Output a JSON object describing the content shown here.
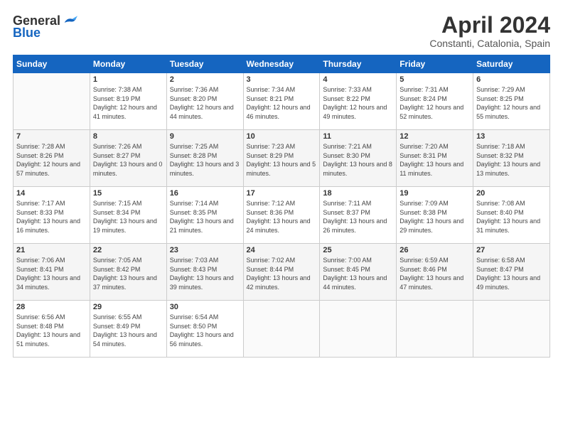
{
  "header": {
    "logo_general": "General",
    "logo_blue": "Blue",
    "month_title": "April 2024",
    "subtitle": "Constanti, Catalonia, Spain"
  },
  "weekdays": [
    "Sunday",
    "Monday",
    "Tuesday",
    "Wednesday",
    "Thursday",
    "Friday",
    "Saturday"
  ],
  "weeks": [
    [
      {
        "day": "",
        "sunrise": "",
        "sunset": "",
        "daylight": ""
      },
      {
        "day": "1",
        "sunrise": "Sunrise: 7:38 AM",
        "sunset": "Sunset: 8:19 PM",
        "daylight": "Daylight: 12 hours and 41 minutes."
      },
      {
        "day": "2",
        "sunrise": "Sunrise: 7:36 AM",
        "sunset": "Sunset: 8:20 PM",
        "daylight": "Daylight: 12 hours and 44 minutes."
      },
      {
        "day": "3",
        "sunrise": "Sunrise: 7:34 AM",
        "sunset": "Sunset: 8:21 PM",
        "daylight": "Daylight: 12 hours and 46 minutes."
      },
      {
        "day": "4",
        "sunrise": "Sunrise: 7:33 AM",
        "sunset": "Sunset: 8:22 PM",
        "daylight": "Daylight: 12 hours and 49 minutes."
      },
      {
        "day": "5",
        "sunrise": "Sunrise: 7:31 AM",
        "sunset": "Sunset: 8:24 PM",
        "daylight": "Daylight: 12 hours and 52 minutes."
      },
      {
        "day": "6",
        "sunrise": "Sunrise: 7:29 AM",
        "sunset": "Sunset: 8:25 PM",
        "daylight": "Daylight: 12 hours and 55 minutes."
      }
    ],
    [
      {
        "day": "7",
        "sunrise": "Sunrise: 7:28 AM",
        "sunset": "Sunset: 8:26 PM",
        "daylight": "Daylight: 12 hours and 57 minutes."
      },
      {
        "day": "8",
        "sunrise": "Sunrise: 7:26 AM",
        "sunset": "Sunset: 8:27 PM",
        "daylight": "Daylight: 13 hours and 0 minutes."
      },
      {
        "day": "9",
        "sunrise": "Sunrise: 7:25 AM",
        "sunset": "Sunset: 8:28 PM",
        "daylight": "Daylight: 13 hours and 3 minutes."
      },
      {
        "day": "10",
        "sunrise": "Sunrise: 7:23 AM",
        "sunset": "Sunset: 8:29 PM",
        "daylight": "Daylight: 13 hours and 5 minutes."
      },
      {
        "day": "11",
        "sunrise": "Sunrise: 7:21 AM",
        "sunset": "Sunset: 8:30 PM",
        "daylight": "Daylight: 13 hours and 8 minutes."
      },
      {
        "day": "12",
        "sunrise": "Sunrise: 7:20 AM",
        "sunset": "Sunset: 8:31 PM",
        "daylight": "Daylight: 13 hours and 11 minutes."
      },
      {
        "day": "13",
        "sunrise": "Sunrise: 7:18 AM",
        "sunset": "Sunset: 8:32 PM",
        "daylight": "Daylight: 13 hours and 13 minutes."
      }
    ],
    [
      {
        "day": "14",
        "sunrise": "Sunrise: 7:17 AM",
        "sunset": "Sunset: 8:33 PM",
        "daylight": "Daylight: 13 hours and 16 minutes."
      },
      {
        "day": "15",
        "sunrise": "Sunrise: 7:15 AM",
        "sunset": "Sunset: 8:34 PM",
        "daylight": "Daylight: 13 hours and 19 minutes."
      },
      {
        "day": "16",
        "sunrise": "Sunrise: 7:14 AM",
        "sunset": "Sunset: 8:35 PM",
        "daylight": "Daylight: 13 hours and 21 minutes."
      },
      {
        "day": "17",
        "sunrise": "Sunrise: 7:12 AM",
        "sunset": "Sunset: 8:36 PM",
        "daylight": "Daylight: 13 hours and 24 minutes."
      },
      {
        "day": "18",
        "sunrise": "Sunrise: 7:11 AM",
        "sunset": "Sunset: 8:37 PM",
        "daylight": "Daylight: 13 hours and 26 minutes."
      },
      {
        "day": "19",
        "sunrise": "Sunrise: 7:09 AM",
        "sunset": "Sunset: 8:38 PM",
        "daylight": "Daylight: 13 hours and 29 minutes."
      },
      {
        "day": "20",
        "sunrise": "Sunrise: 7:08 AM",
        "sunset": "Sunset: 8:40 PM",
        "daylight": "Daylight: 13 hours and 31 minutes."
      }
    ],
    [
      {
        "day": "21",
        "sunrise": "Sunrise: 7:06 AM",
        "sunset": "Sunset: 8:41 PM",
        "daylight": "Daylight: 13 hours and 34 minutes."
      },
      {
        "day": "22",
        "sunrise": "Sunrise: 7:05 AM",
        "sunset": "Sunset: 8:42 PM",
        "daylight": "Daylight: 13 hours and 37 minutes."
      },
      {
        "day": "23",
        "sunrise": "Sunrise: 7:03 AM",
        "sunset": "Sunset: 8:43 PM",
        "daylight": "Daylight: 13 hours and 39 minutes."
      },
      {
        "day": "24",
        "sunrise": "Sunrise: 7:02 AM",
        "sunset": "Sunset: 8:44 PM",
        "daylight": "Daylight: 13 hours and 42 minutes."
      },
      {
        "day": "25",
        "sunrise": "Sunrise: 7:00 AM",
        "sunset": "Sunset: 8:45 PM",
        "daylight": "Daylight: 13 hours and 44 minutes."
      },
      {
        "day": "26",
        "sunrise": "Sunrise: 6:59 AM",
        "sunset": "Sunset: 8:46 PM",
        "daylight": "Daylight: 13 hours and 47 minutes."
      },
      {
        "day": "27",
        "sunrise": "Sunrise: 6:58 AM",
        "sunset": "Sunset: 8:47 PM",
        "daylight": "Daylight: 13 hours and 49 minutes."
      }
    ],
    [
      {
        "day": "28",
        "sunrise": "Sunrise: 6:56 AM",
        "sunset": "Sunset: 8:48 PM",
        "daylight": "Daylight: 13 hours and 51 minutes."
      },
      {
        "day": "29",
        "sunrise": "Sunrise: 6:55 AM",
        "sunset": "Sunset: 8:49 PM",
        "daylight": "Daylight: 13 hours and 54 minutes."
      },
      {
        "day": "30",
        "sunrise": "Sunrise: 6:54 AM",
        "sunset": "Sunset: 8:50 PM",
        "daylight": "Daylight: 13 hours and 56 minutes."
      },
      {
        "day": "",
        "sunrise": "",
        "sunset": "",
        "daylight": ""
      },
      {
        "day": "",
        "sunrise": "",
        "sunset": "",
        "daylight": ""
      },
      {
        "day": "",
        "sunrise": "",
        "sunset": "",
        "daylight": ""
      },
      {
        "day": "",
        "sunrise": "",
        "sunset": "",
        "daylight": ""
      }
    ]
  ]
}
